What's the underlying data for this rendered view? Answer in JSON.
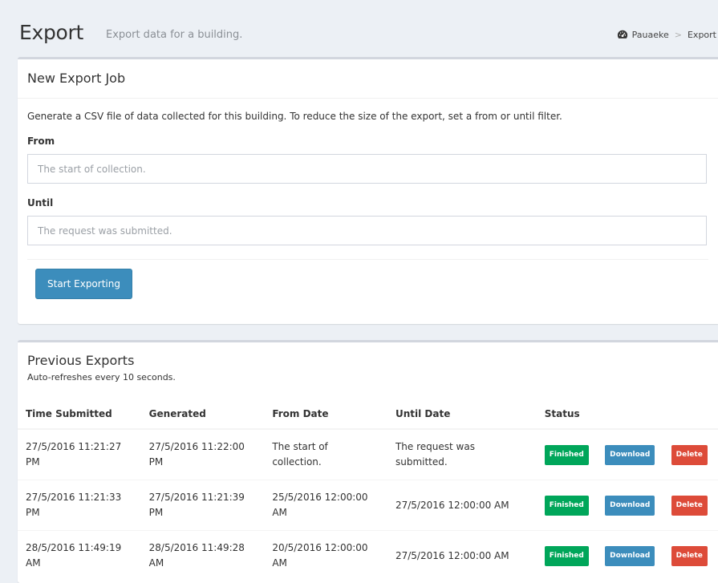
{
  "header": {
    "title": "Export",
    "subtitle": "Export data for a building.",
    "breadcrumb": {
      "icon": "dashboard-icon",
      "items": [
        "Pauaeke",
        "Export"
      ],
      "separator": ">"
    }
  },
  "export_job": {
    "title": "New Export Job",
    "description": "Generate a CSV file of data collected for this building. To reduce the size of the export, set a from or until filter.",
    "from_label": "From",
    "from_placeholder": "The start of collection.",
    "from_value": "",
    "until_label": "Until",
    "until_placeholder": "The request was submitted.",
    "until_value": "",
    "submit_label": "Start Exporting"
  },
  "previous_exports": {
    "title": "Previous Exports",
    "subtitle": "Auto-refreshes every 10 seconds.",
    "columns": [
      "Time Submitted",
      "Generated",
      "From Date",
      "Until Date",
      "Status",
      "",
      ""
    ],
    "rows": [
      {
        "time_submitted": "27/5/2016 11:21:27 PM",
        "generated": "27/5/2016 11:22:00 PM",
        "from_date": "The start of collection.",
        "until_date": "The request was submitted.",
        "status": "Finished",
        "download_label": "Download",
        "delete_label": "Delete"
      },
      {
        "time_submitted": "27/5/2016 11:21:33 PM",
        "generated": "27/5/2016 11:21:39 PM",
        "from_date": "25/5/2016 12:00:00 AM",
        "until_date": "27/5/2016 12:00:00 AM",
        "status": "Finished",
        "download_label": "Download",
        "delete_label": "Delete"
      },
      {
        "time_submitted": "28/5/2016 11:49:19 AM",
        "generated": "28/5/2016 11:49:28 AM",
        "from_date": "20/5/2016 12:00:00 AM",
        "until_date": "27/5/2016 12:00:00 AM",
        "status": "Finished",
        "download_label": "Download",
        "delete_label": "Delete"
      }
    ]
  },
  "colors": {
    "background": "#ecf0f5",
    "primary": "#3c8dbc",
    "success": "#00a65a",
    "danger": "#dd4b39",
    "box_border": "#d2d6de"
  }
}
